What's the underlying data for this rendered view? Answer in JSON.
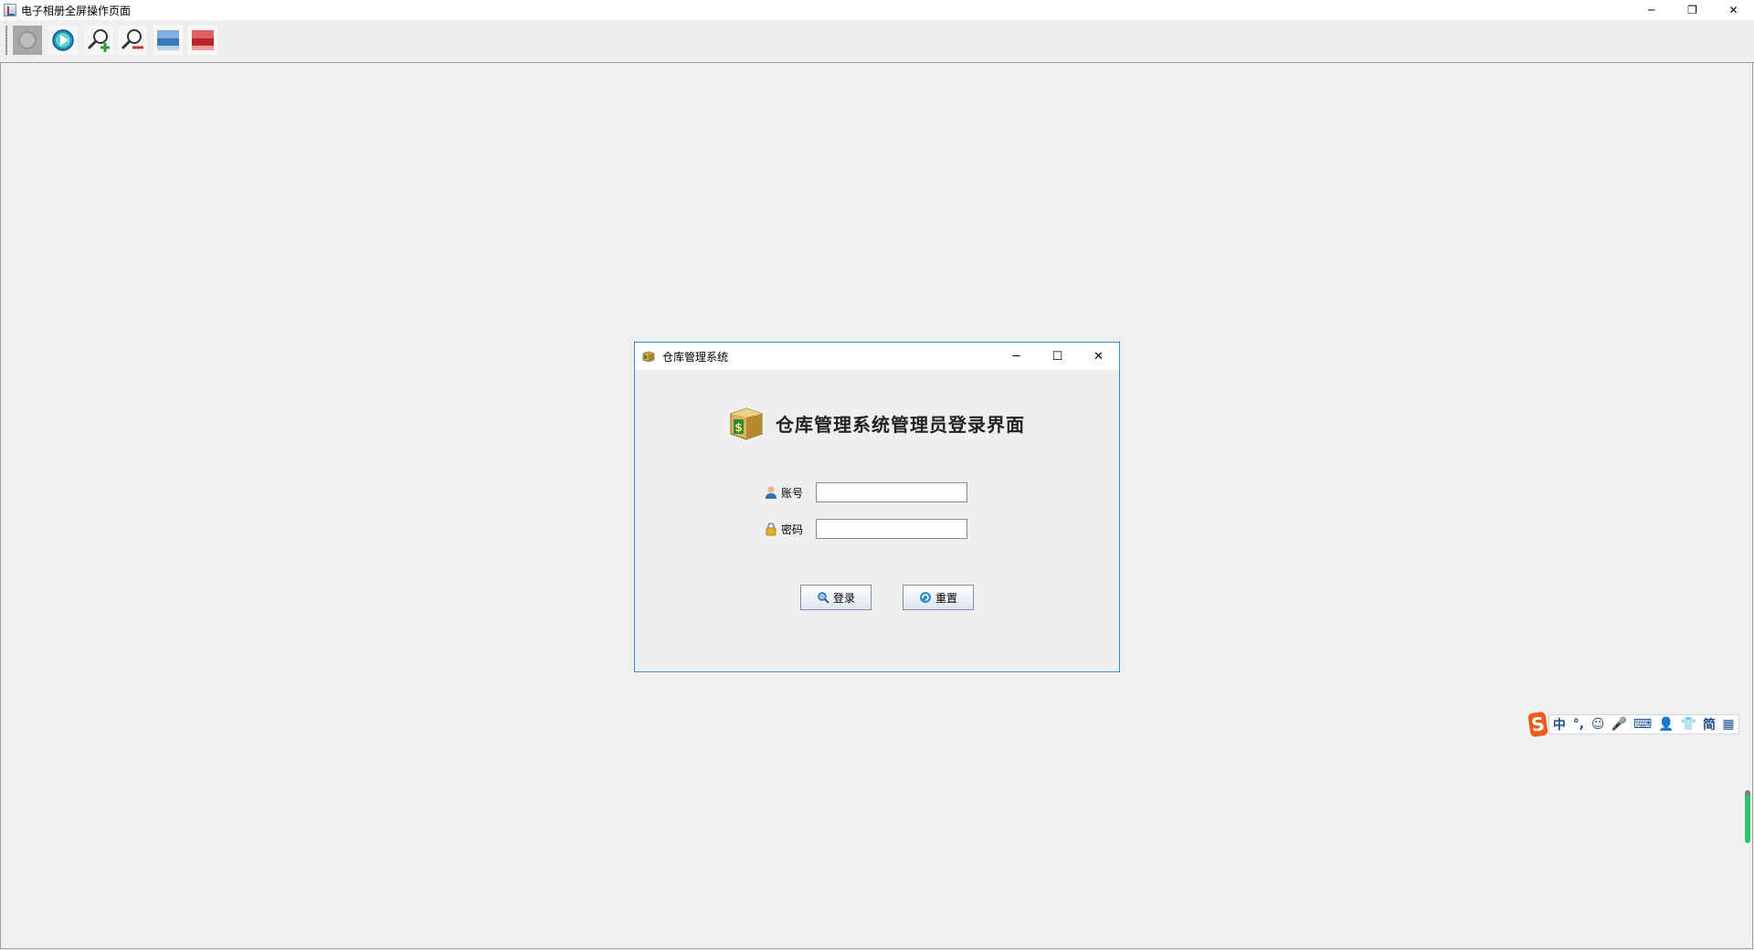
{
  "window": {
    "title": "电子相册全屏操作页面",
    "controls": {
      "minimize": "─",
      "restore": "❐",
      "close": "✕"
    }
  },
  "toolbar": {
    "buttons": [
      {
        "name": "toolbar-button-disabled",
        "icon": "gray-circle-icon"
      },
      {
        "name": "toolbar-button-play",
        "icon": "play-icon"
      },
      {
        "name": "toolbar-button-zoom-in",
        "icon": "zoom-in-icon"
      },
      {
        "name": "toolbar-button-zoom-out",
        "icon": "zoom-out-icon"
      },
      {
        "name": "toolbar-button-blue",
        "icon": "blue-panel-icon"
      },
      {
        "name": "toolbar-button-red",
        "icon": "red-panel-icon"
      }
    ]
  },
  "dialog": {
    "title": "仓库管理系统",
    "controls": {
      "minimize": "─",
      "maximize": "☐",
      "close": "✕"
    },
    "heading": "仓库管理系统管理员登录界面",
    "account": {
      "label": "账号",
      "value": ""
    },
    "password": {
      "label": "密码",
      "value": ""
    },
    "login_button": "登录",
    "reset_button": "重置"
  },
  "ime": {
    "items": [
      "中",
      "°,",
      "☺",
      "🎤",
      "⌨",
      "👤",
      "👕",
      "简",
      "▦"
    ]
  },
  "colors": {
    "dialog_border": "#3c8ad0",
    "background": "#f0f0f0",
    "ime_logo": "#f05a1a"
  }
}
